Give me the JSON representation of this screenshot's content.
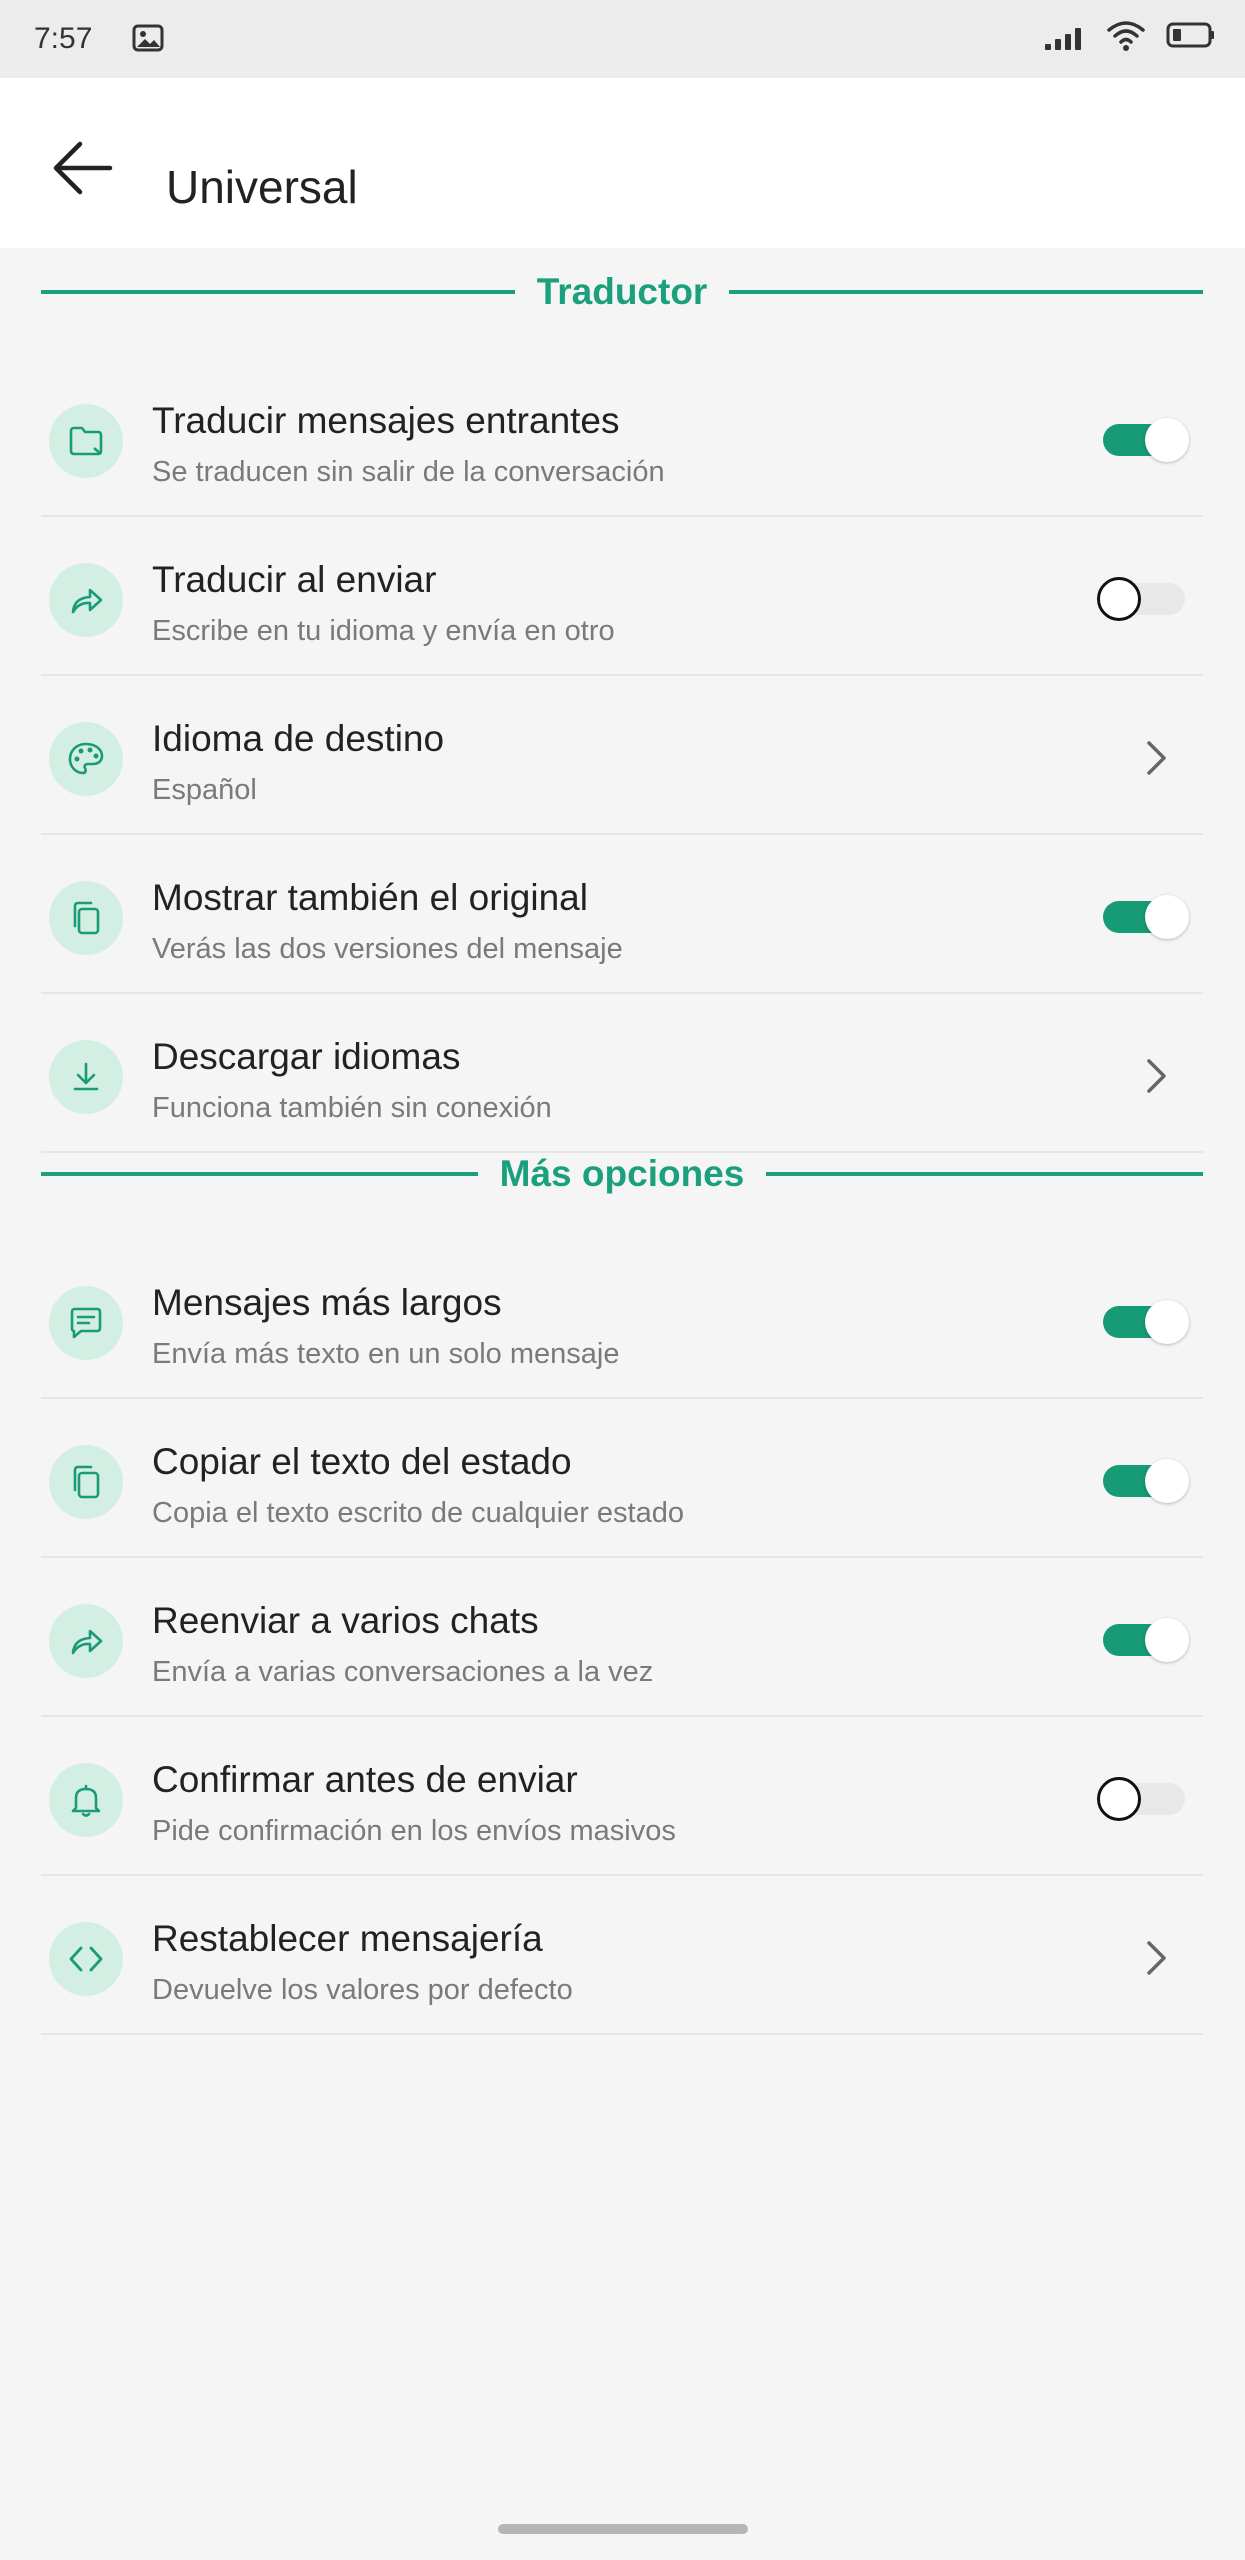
{
  "status_bar": {
    "time": "7:57",
    "icons": [
      "image-icon",
      "signal-icon",
      "wifi-icon",
      "battery-icon"
    ]
  },
  "app_bar": {
    "back_icon": "arrow-left-icon",
    "title": "Universal"
  },
  "colors": {
    "accent": "#1aa07c",
    "toggle_on": "#169b74",
    "icon_bg": "#d3efe4",
    "background": "#f5f5f5"
  },
  "sections": [
    {
      "title": "Traductor",
      "items": [
        {
          "title": "Traducir mensajes entrantes",
          "subtitle": "Se traducen sin salir de la conversación",
          "icon": "folder-icon",
          "control": "toggle",
          "on": true
        },
        {
          "title": "Traducir al enviar",
          "subtitle": "Escribe en tu idioma y envía en otro",
          "icon": "share-arrow-icon",
          "control": "toggle",
          "on": false
        },
        {
          "title": "Idioma de destino",
          "subtitle": "Español",
          "icon": "palette-icon",
          "control": "chevron"
        },
        {
          "title": "Mostrar también el original",
          "subtitle": "Verás las dos versiones del mensaje",
          "icon": "copy-icon",
          "control": "toggle",
          "on": true
        },
        {
          "title": "Descargar idiomas",
          "subtitle": "Funciona también sin conexión",
          "icon": "download-icon",
          "control": "chevron"
        }
      ]
    },
    {
      "title": "Más opciones",
      "items": [
        {
          "title": "Mensajes más largos",
          "subtitle": "Envía más texto en un solo mensaje",
          "icon": "message-icon",
          "control": "toggle",
          "on": true
        },
        {
          "title": "Copiar el texto del estado",
          "subtitle": "Copia el texto escrito de cualquier estado",
          "icon": "copy-icon",
          "control": "toggle",
          "on": true
        },
        {
          "title": "Reenviar a varios chats",
          "subtitle": "Envía a varias conversaciones a la vez",
          "icon": "share-arrow-icon",
          "control": "toggle",
          "on": true
        },
        {
          "title": "Confirmar antes de enviar",
          "subtitle": "Pide confirmación en los envíos masivos",
          "icon": "bell-icon",
          "control": "toggle",
          "on": false
        },
        {
          "title": "Restablecer mensajería",
          "subtitle": "Devuelve los valores por defecto",
          "icon": "code-icon",
          "control": "chevron"
        }
      ]
    }
  ]
}
